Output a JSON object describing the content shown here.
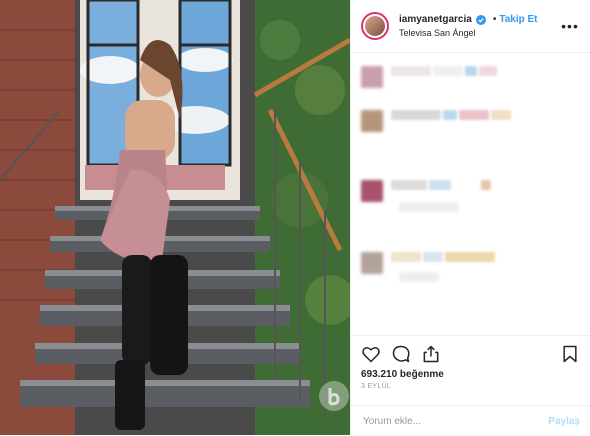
{
  "header": {
    "username": "iamyanetgarcia",
    "separator": "•",
    "follow_label": "Takip Et",
    "location": "Televisa San Ángel",
    "more_label": "•••"
  },
  "actions": {
    "likes": "693.210 beğenme",
    "date": "3 EYLÜL"
  },
  "comment_box": {
    "placeholder": "Yorum ekle...",
    "post_label": "Paylaş"
  },
  "colors": {
    "link": "#3897f0",
    "post_disabled": "#b2dffc",
    "text": "#262626",
    "muted": "#999999"
  },
  "icons": [
    "verified-badge-icon",
    "heart-icon",
    "comment-icon",
    "share-icon",
    "bookmark-icon",
    "more-options-icon"
  ]
}
